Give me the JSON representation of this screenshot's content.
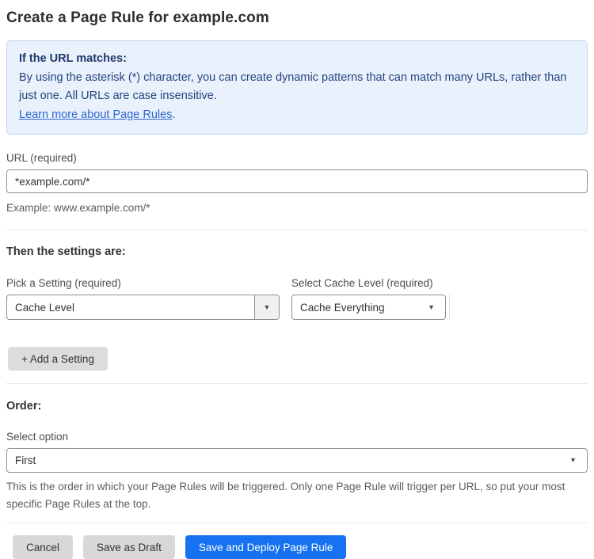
{
  "page": {
    "title": "Create a Page Rule for example.com"
  },
  "info_box": {
    "heading": "If the URL matches:",
    "body": "By using the asterisk (*) character, you can create dynamic patterns that can match many URLs, rather than just one. All URLs are case insensitive.",
    "link_label": "Learn more about Page Rules",
    "link_suffix": "."
  },
  "url_field": {
    "label": "URL (required)",
    "value": "*example.com/*",
    "helper": "Example: www.example.com/*"
  },
  "settings_section": {
    "heading": "Then the settings are:",
    "setting_picker": {
      "label": "Pick a Setting (required)",
      "value": "Cache Level"
    },
    "cache_level_picker": {
      "label": "Select Cache Level (required)",
      "value": "Cache Everything"
    },
    "add_setting_label": "+ Add a Setting"
  },
  "order_section": {
    "heading": "Order:",
    "select_label": "Select option",
    "selected_value": "First",
    "helper": "This is the order in which your Page Rules will be triggered. Only one Page Rule will trigger per URL, so put your most specific Page Rules at the top."
  },
  "footer": {
    "cancel_label": "Cancel",
    "save_draft_label": "Save as Draft",
    "save_deploy_label": "Save and Deploy Page Rule"
  },
  "icons": {
    "dropdown_caret": "▼"
  },
  "colors": {
    "accent_blue": "#1672f1",
    "info_bg": "#e8f1fc",
    "info_border": "#bdd7f3",
    "info_text": "#27457d",
    "link_blue": "#2e66d0",
    "button_gray": "#d8d8d8"
  }
}
